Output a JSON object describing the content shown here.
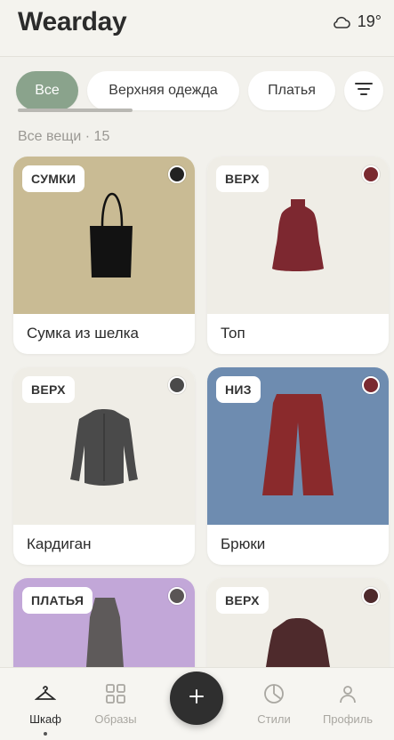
{
  "header": {
    "title": "Wearday",
    "temperature": "19°",
    "weather_icon": "cloud-icon"
  },
  "filters": {
    "chips": [
      "Все",
      "Верхняя одежда",
      "Платья"
    ],
    "active": "Все",
    "filter_icon": "filter-icon"
  },
  "section": {
    "label": "Все вещи · 15"
  },
  "items": [
    {
      "badge": "СУМКИ",
      "name": "Сумка из шелка",
      "bg": "#c9bb94",
      "dot": "#222222"
    },
    {
      "badge": "ВЕРХ",
      "name": "Топ",
      "bg": "#efede6",
      "dot": "#7a2a30"
    },
    {
      "badge": "ВЕРХ",
      "name": "Кардиган",
      "bg": "#efede6",
      "dot": "#4a4a4a"
    },
    {
      "badge": "НИЗ",
      "name": "Брюки",
      "bg": "#6e8cb0",
      "dot": "#7a2a30"
    },
    {
      "badge": "ПЛАТЬЯ",
      "name": "",
      "bg": "#c2a7d8",
      "dot": "#5a5555"
    },
    {
      "badge": "ВЕРХ",
      "name": "",
      "bg": "#efede6",
      "dot": "#4e2a2c"
    }
  ],
  "nav": {
    "items": [
      {
        "label": "Шкаф",
        "icon": "hanger-icon",
        "active": true
      },
      {
        "label": "Образы",
        "icon": "grid-icon",
        "active": false
      },
      {
        "label": "Стили",
        "icon": "pie-chart-icon",
        "active": false
      },
      {
        "label": "Профиль",
        "icon": "user-icon",
        "active": false
      }
    ],
    "add_icon": "plus-icon"
  },
  "colors": {
    "accent": "#8aa38c",
    "background": "#f2f1ec",
    "fab": "#2f2f2f"
  }
}
